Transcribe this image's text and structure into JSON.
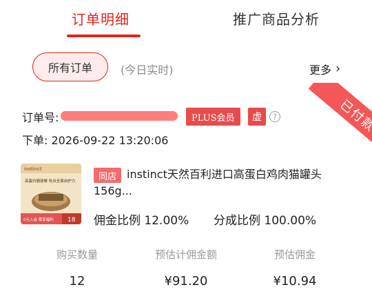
{
  "tabs": [
    {
      "label": "订单明细",
      "active": true
    },
    {
      "label": "推广商品分析",
      "active": false
    }
  ],
  "filter": {
    "pill_label": "所有订单",
    "sub_label": "(今日实时)",
    "more_label": "更多"
  },
  "order": {
    "number_label": "订单号:",
    "plus_badge": "PLUS会员",
    "virtual_badge": "虚",
    "help": "?",
    "placed_label": "下单:",
    "placed_time": "2026-09-22 13:20:06",
    "status_ribbon": "已付款"
  },
  "product": {
    "store_badge": "同店",
    "title": "instinct天然百利进口高蛋白鸡肉猫罐头156g...",
    "commission_label": "佣金比例",
    "commission_value": "12.00%",
    "share_label": "分成比例",
    "share_value": "100.00%",
    "thumb": {
      "brand": "instinct",
      "promo": "高蛋白健康餐 吃出全面自护力",
      "badge": "0元入会 尊享福利",
      "count": "18"
    }
  },
  "stats": [
    {
      "label": "购买数量",
      "value": "12"
    },
    {
      "label": "预估计佣金额",
      "value": "¥91.20"
    },
    {
      "label": "预估佣金",
      "value": "¥10.94"
    }
  ],
  "colors": {
    "accent": "#e2231a",
    "badge": "#e74c4c",
    "ribbon": "#f35757"
  }
}
